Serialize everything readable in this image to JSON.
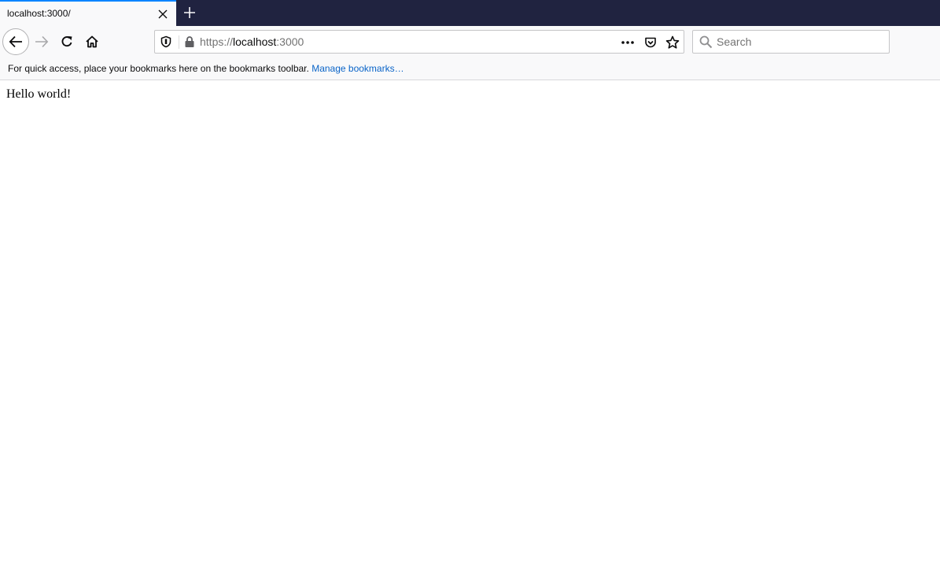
{
  "tab": {
    "title": "localhost:3000/",
    "close_icon": "close-icon",
    "new_tab_icon": "plus-icon"
  },
  "nav": {
    "back_icon": "arrow-left-icon",
    "forward_icon": "arrow-right-icon",
    "reload_icon": "reload-icon",
    "home_icon": "home-icon"
  },
  "urlbar": {
    "scheme": "https://",
    "host": "localhost",
    "port": ":3000",
    "shield_icon": "tracking-shield-icon",
    "lock_icon": "lock-icon",
    "more_icon": "more-dots-icon",
    "pocket_icon": "pocket-icon",
    "star_icon": "star-icon"
  },
  "searchbar": {
    "placeholder": "Search",
    "value": ""
  },
  "bookmarks": {
    "message": "For quick access, place your bookmarks here on the bookmarks toolbar.",
    "link": "Manage bookmarks…"
  },
  "page": {
    "text": "Hello world!"
  },
  "colors": {
    "tabbar_bg": "#202340",
    "active_tab_accent": "#0a84ff",
    "link": "#0a64c8"
  }
}
